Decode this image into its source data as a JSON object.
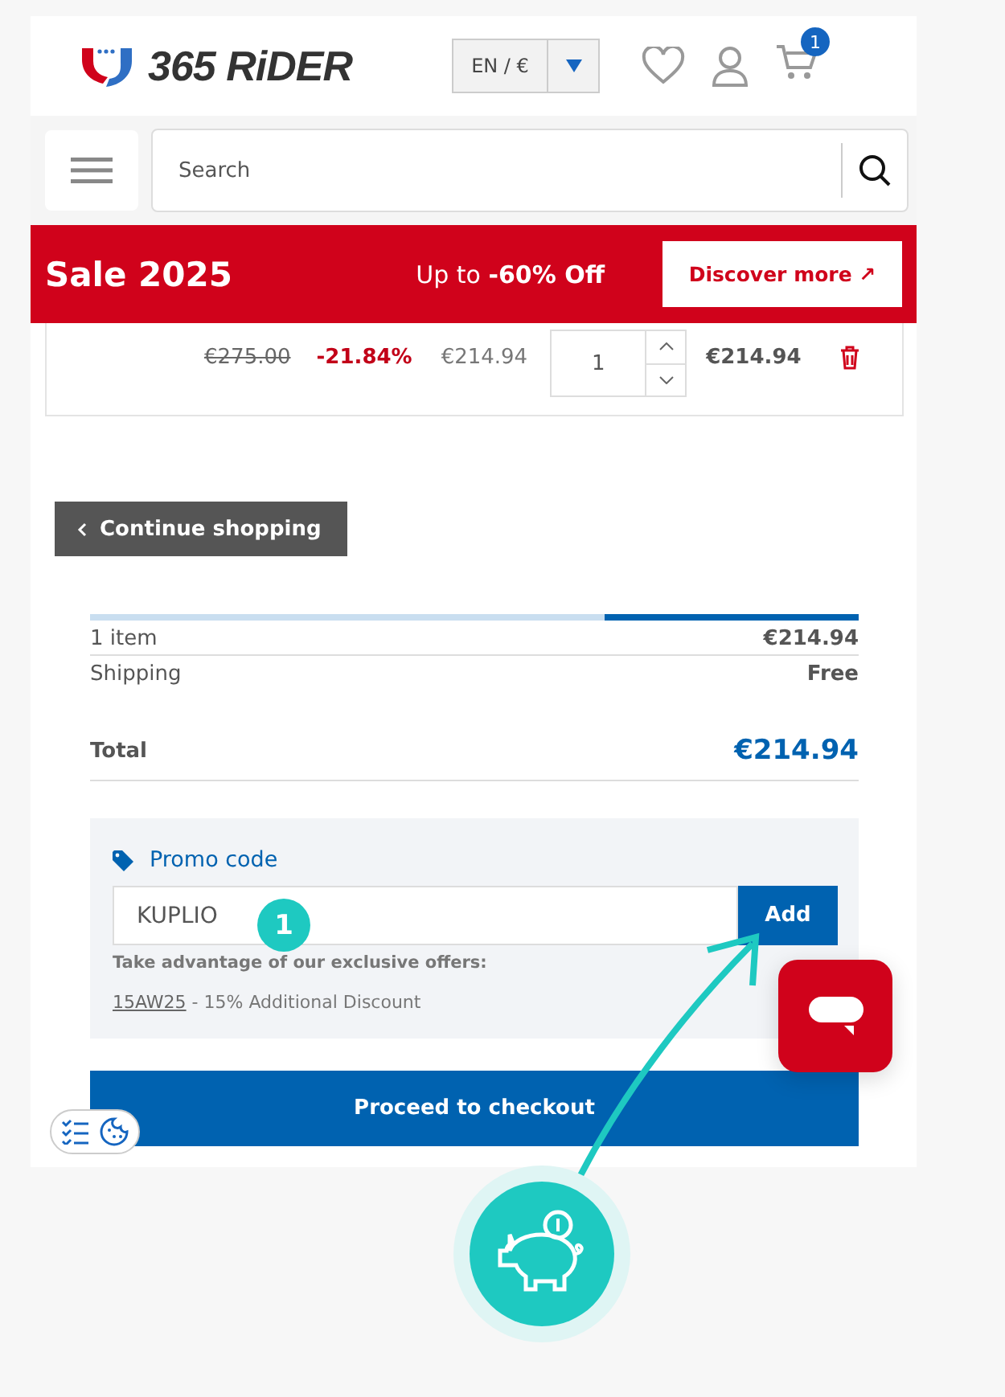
{
  "header": {
    "logo": "365 RiDER",
    "language": "EN / €",
    "cart_count": "1"
  },
  "search": {
    "placeholder": "Search"
  },
  "sale_banner": {
    "title": "Sale 2025",
    "offer_prefix": "Up to ",
    "offer_bold": "-60% Off",
    "button": "Discover more ↗"
  },
  "cart_item": {
    "old_price": "€275.00",
    "discount": "-21.84%",
    "unit_price": "€214.94",
    "quantity": "1",
    "total": "€214.94"
  },
  "continue_button": "Continue shopping",
  "progress": {
    "level": 0.33
  },
  "summary": {
    "rows": [
      {
        "label": "1 item",
        "value": "€214.94"
      },
      {
        "label": "Shipping",
        "value": "Free"
      }
    ],
    "total_label": "Total",
    "total_value": "€214.94"
  },
  "promo": {
    "title": "Promo code",
    "value": "KUPLIO",
    "button": "Add",
    "offers_title": "Take advantage of our exclusive offers:",
    "offer_code": "15AW25",
    "offer_text": " - 15% Additional Discount"
  },
  "checkout_button": "Proceed to checkout",
  "step_badge": "1"
}
